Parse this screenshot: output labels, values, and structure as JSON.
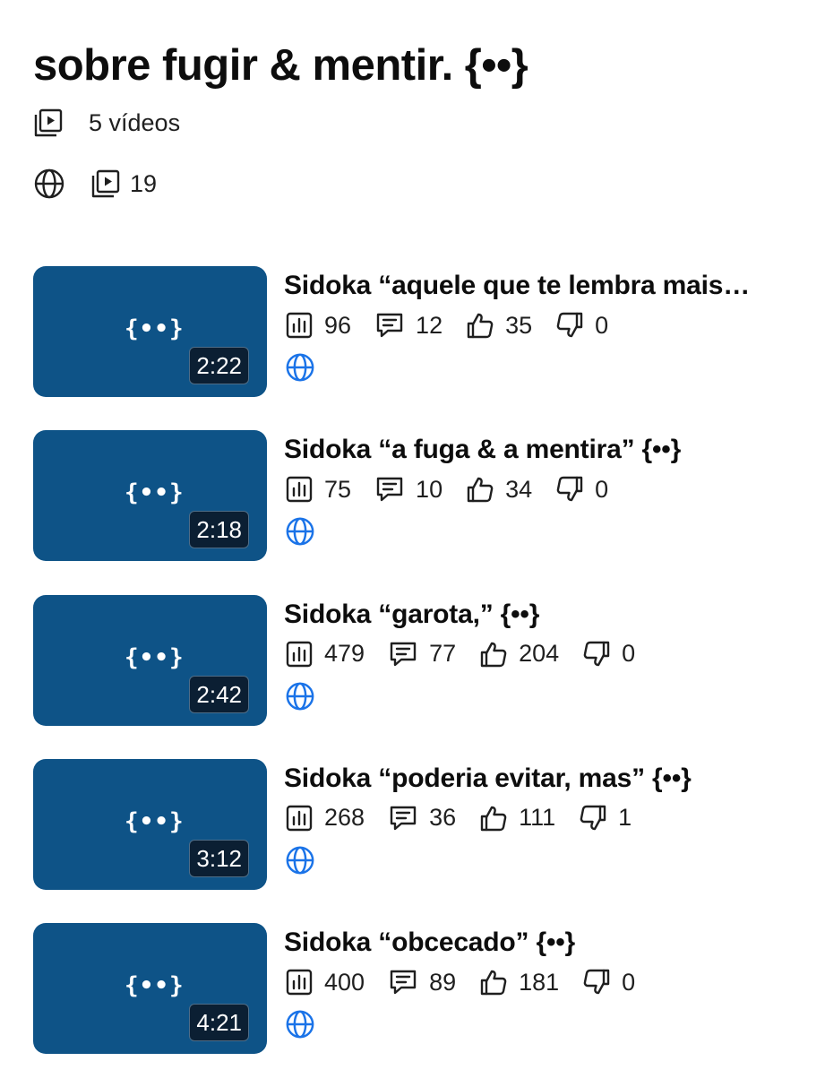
{
  "playlist": {
    "title": "sobre fugir & mentir. {••}",
    "video_count_label": "5 vídeos",
    "plays_count": "19"
  },
  "thumbnail_logo": "{••}",
  "colors": {
    "thumbnail_bg": "#0e5387",
    "duration_badge_bg": "#0b1f33",
    "globe_blue": "#1a73e8"
  },
  "videos": [
    {
      "title": "Sidoka “aquele que te lembra mais…",
      "duration": "2:22",
      "views": "96",
      "comments": "12",
      "likes": "35",
      "dislikes": "0"
    },
    {
      "title": "Sidoka “a fuga & a mentira” {••}",
      "duration": "2:18",
      "views": "75",
      "comments": "10",
      "likes": "34",
      "dislikes": "0"
    },
    {
      "title": "Sidoka “garota,” {••}",
      "duration": "2:42",
      "views": "479",
      "comments": "77",
      "likes": "204",
      "dislikes": "0"
    },
    {
      "title": "Sidoka “poderia evitar, mas” {••}",
      "duration": "3:12",
      "views": "268",
      "comments": "36",
      "likes": "111",
      "dislikes": "1"
    },
    {
      "title": "Sidoka “obcecado” {••}",
      "duration": "4:21",
      "views": "400",
      "comments": "89",
      "likes": "181",
      "dislikes": "0"
    }
  ]
}
